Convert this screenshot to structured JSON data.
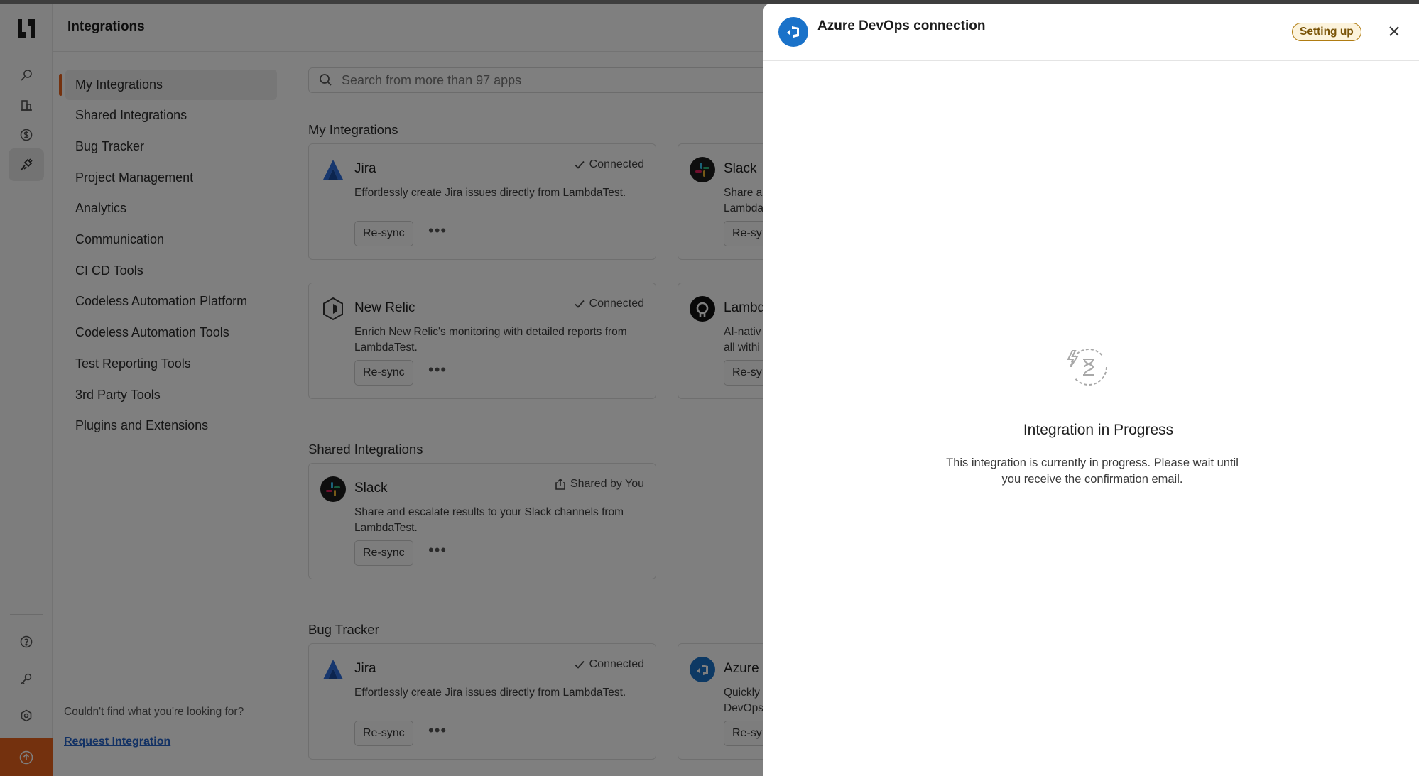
{
  "header": {
    "title": "Integrations"
  },
  "categories": [
    "My Integrations",
    "Shared Integrations",
    "Bug Tracker",
    "Project Management",
    "Analytics",
    "Communication",
    "CI CD Tools",
    "Codeless Automation Platform",
    "Codeless Automation Tools",
    "Test Reporting Tools",
    "3rd Party Tools",
    "Plugins and Extensions"
  ],
  "sidebar_footer": {
    "help": "Couldn't find what you're looking for?",
    "request": "Request Integration"
  },
  "search": {
    "placeholder": "Search from more than 97 apps"
  },
  "sections": {
    "my": "My Integrations",
    "shared": "Shared Integrations",
    "bug": "Bug Tracker"
  },
  "cards": {
    "jira1": {
      "name": "Jira",
      "status": "Connected",
      "desc": "Effortlessly create Jira issues directly from LambdaTest.",
      "button": "Re-sync"
    },
    "slack1": {
      "name": "Slack",
      "desc_a": "Share a",
      "desc_b": "Lambda",
      "button": "Re-sy"
    },
    "newrelic": {
      "name": "New Relic",
      "status": "Connected",
      "desc": "Enrich New Relic's monitoring with detailed reports from LambdaTest.",
      "button": "Re-sync"
    },
    "lambda": {
      "name": "Lambd",
      "desc_a": "AI-nativ",
      "desc_b": "all withi",
      "button": "Re-sy"
    },
    "slack2": {
      "name": "Slack",
      "status": "Shared by You",
      "desc": "Share and escalate results to your Slack channels from LambdaTest.",
      "button": "Re-sync"
    },
    "jira2": {
      "name": "Jira",
      "status": "Connected",
      "desc": "Effortlessly create Jira issues directly from LambdaTest.",
      "button": "Re-sync"
    },
    "azure": {
      "name": "Azure",
      "desc_a": "Quickly",
      "desc_b": "DevOps",
      "button": "Re-sy"
    }
  },
  "drawer": {
    "title": "Azure DevOps connection",
    "badge": "Setting up",
    "progress_title": "Integration in Progress",
    "progress_desc": "This integration is currently in progress. Please wait until you receive the confirmation email."
  },
  "colors": {
    "accent": "#e8621c",
    "azure": "#1a72c9",
    "badge_border": "#b07c12",
    "link": "#2563c9"
  }
}
